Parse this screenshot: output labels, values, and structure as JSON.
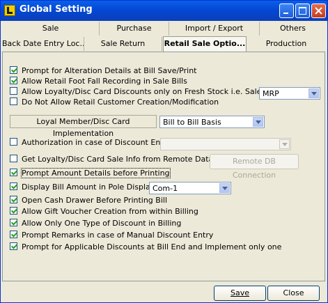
{
  "window": {
    "title": "Global Setting"
  },
  "tabs_row1": [
    "Sale",
    "Purchase",
    "Import / Export",
    "Others"
  ],
  "tabs_row2": [
    "Back Date Entry Loc...",
    "Sale Return",
    "Retail Sale Optio...",
    "Production"
  ],
  "options": {
    "prompt_alteration": {
      "label": "Prompt for Alteration Details at Bill Save/Print",
      "checked": true
    },
    "allow_foot_fall": {
      "label": "Allow Retail Foot Fall Recording in Sale Bills",
      "checked": true
    },
    "loyalty_fresh_stock": {
      "label": "Allow Loyalty/Disc Card Discounts only on Fresh Stock i.e. Sale Rate=",
      "checked": false
    },
    "no_customer_creation": {
      "label": "Do Not Allow Retail Customer Creation/Modification",
      "checked": false
    },
    "authorization_discount": {
      "label": "Authorization in case of Discount Entry",
      "checked": false
    },
    "remote_db_info": {
      "label": "Get Loyalty/Disc Card Sale Info from Remote Database",
      "checked": false
    },
    "prompt_amount": {
      "label": "Prompt Amount Details before Printing",
      "checked": true
    },
    "pole_display": {
      "label": "Display Bill Amount in Pole Display",
      "checked": true
    },
    "cash_drawer": {
      "label": "Open Cash Drawer Before Printing Bill",
      "checked": true
    },
    "gift_voucher": {
      "label": "Allow Gift Voucher Creation from within Billing",
      "checked": true
    },
    "one_discount": {
      "label": "Allow Only One Type of Discount in Billing",
      "checked": true
    },
    "prompt_remarks": {
      "label": "Prompt Remarks in case of Manual Discount Entry",
      "checked": true
    },
    "applicable_discounts": {
      "label": "Prompt for Applicable Discounts at Bill End and Implement only one",
      "checked": true
    }
  },
  "sale_rate_select": {
    "value": "MRP"
  },
  "loyal_member": {
    "label": "Loyal Member/Disc Card Implementation",
    "value": "Bill to Bill Basis"
  },
  "authorization_select": {
    "value": ""
  },
  "remote_db_button": {
    "label": "Remote DB Connection"
  },
  "pole_display_port": {
    "value": "Com-1"
  },
  "buttons": {
    "save": "Save",
    "close": "Close"
  }
}
